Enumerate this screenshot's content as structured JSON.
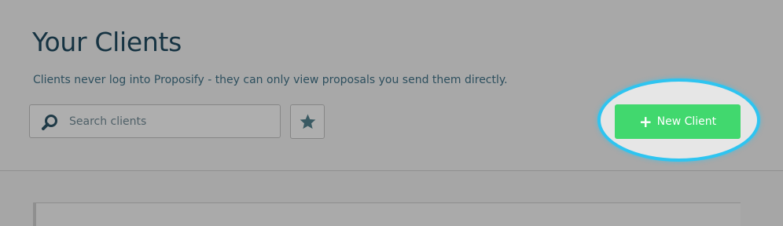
{
  "header": {
    "title": "Your Clients",
    "subtitle": "Clients never log into Proposify - they can only view proposals you send them directly."
  },
  "search": {
    "placeholder": "Search clients",
    "value": "",
    "icon": "search-icon"
  },
  "favorites": {
    "icon": "star-icon"
  },
  "actions": {
    "new_client_label": "New Client",
    "new_client_icon": "plus-icon"
  },
  "colors": {
    "accent_green": "#41d86e",
    "highlight_ring": "#2ec4f0",
    "title_text": "#163342"
  }
}
